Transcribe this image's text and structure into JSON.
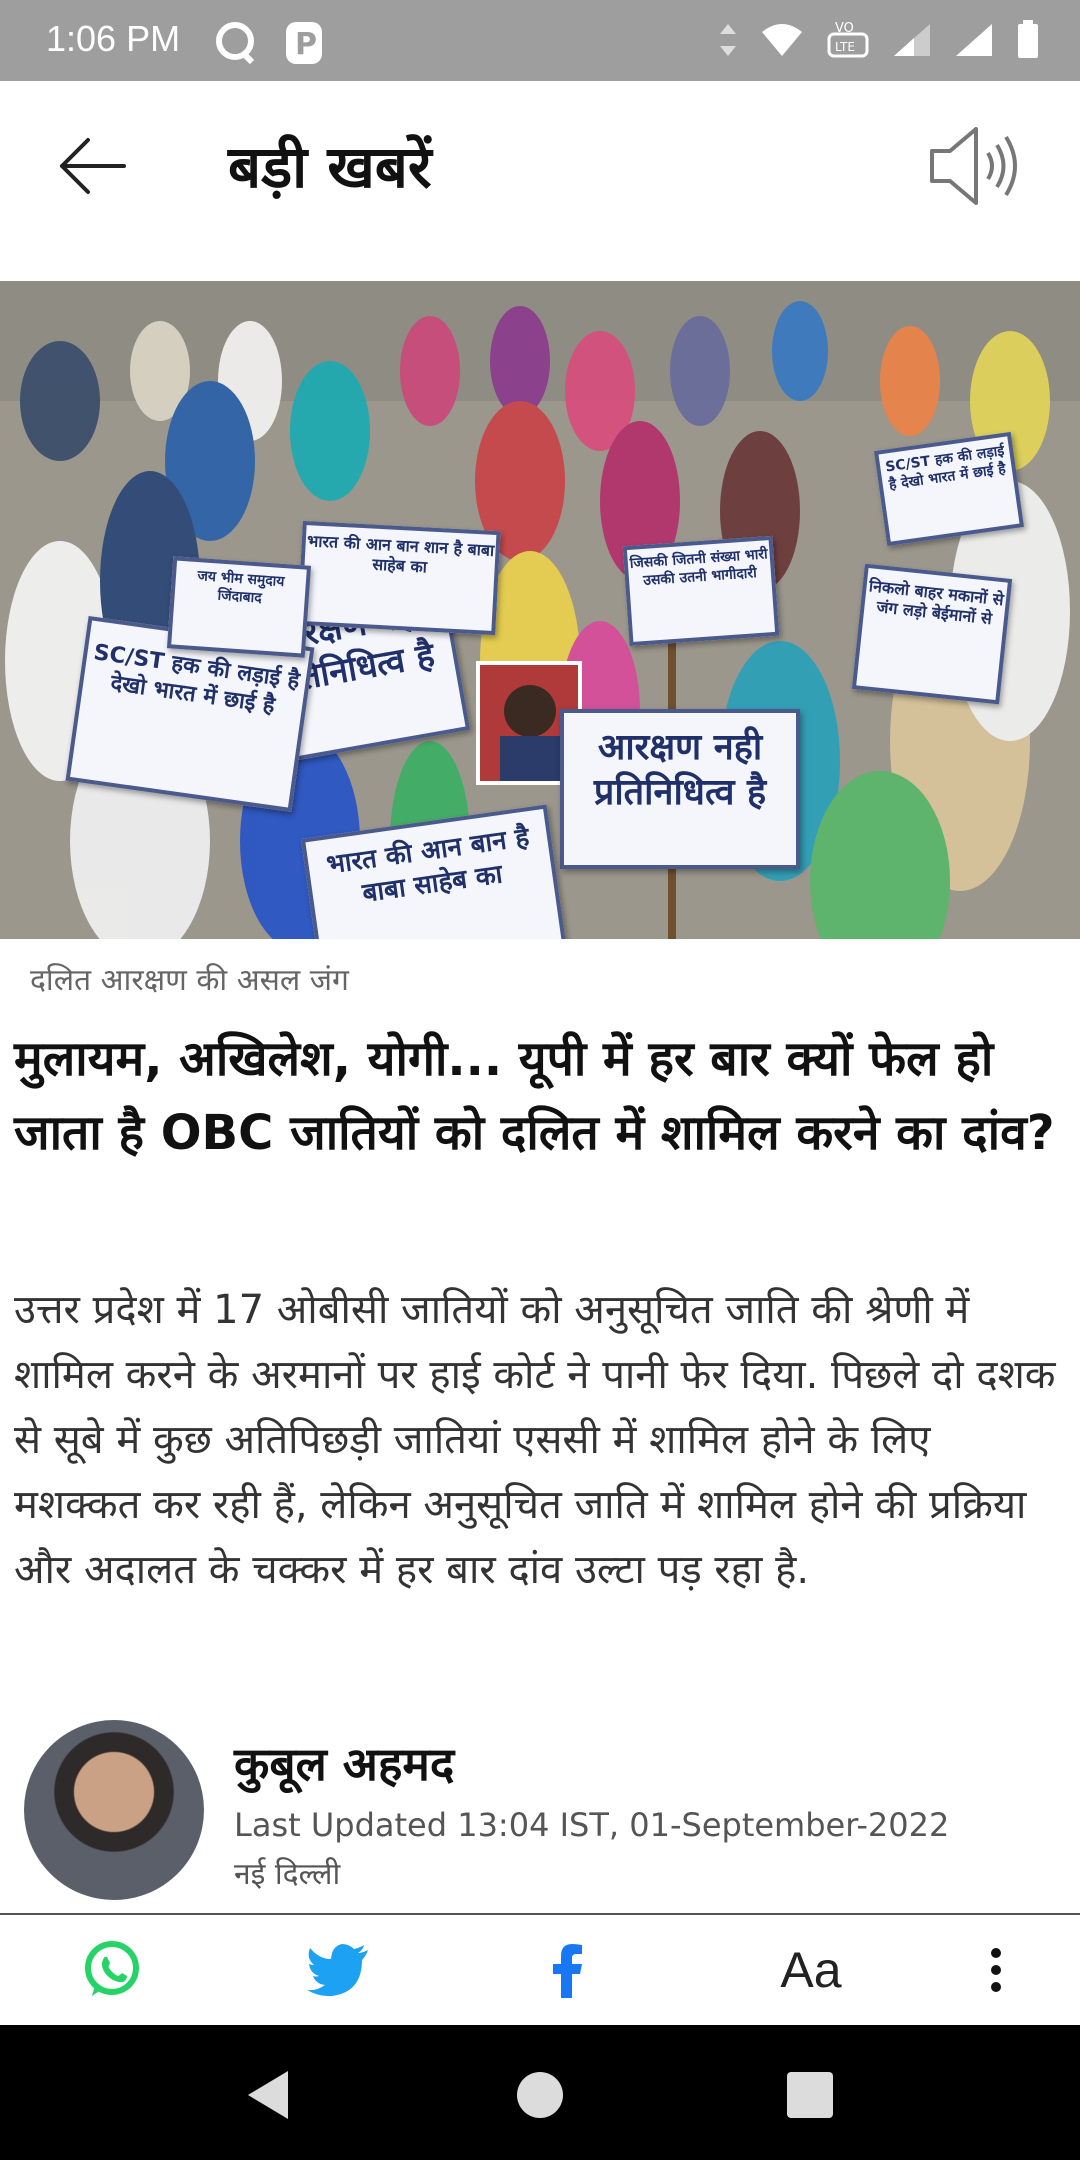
{
  "status_bar": {
    "time": "1:06 PM",
    "network_label": "VoLTE"
  },
  "app_bar": {
    "title": "बड़ी खबरें"
  },
  "hero_image": {
    "placards": [
      "आरक्षण नही प्रतिनिधित्व है",
      "आरक्षण नही प्रतिनिधित्व है",
      "SC/ST हक की लड़ाई है देखो भारत में छाई है",
      "SC/ST हक की लड़ाई है देखो भारत में छाई है",
      "भारत की आन बान शान है बाबा साहेब का",
      "भारत की आन बान है बाबा साहेब का",
      "जिसकी जितनी संख्या भारी उसकी उतनी भागीदारी",
      "जय भीम समुदाय जिंदाबाद",
      "निकलो बाहर मकानों से जंग लड़ो बेईमानों से"
    ]
  },
  "article": {
    "category_caption": "दलित आरक्षण की असल जंग",
    "headline": "मुलायम, अखिलेश, योगी... यूपी में हर बार क्यों फेल हो जाता है OBC जातियों को दलित में शामिल करने का दांव?",
    "summary": "उत्तर प्रदेश में 17 ओबीसी जातियों को अनुसूचित जाति की श्रेणी में शामिल करने के अरमानों पर हाई कोर्ट ने पानी फेर दिया. पिछले दो दशक से सूबे में कुछ अतिपिछड़ी जातियां एससी में शामिल होने के लिए मशक्कत कर रही हैं, लेकिन अनुसूचित जाति में शामिल होने की प्रक्रिया और अदालत के चक्कर में हर बार दांव उल्टा पड़ रहा है.",
    "author": {
      "name": "कुबूल अहमद",
      "updated": "Last Updated 13:04 IST, 01-September-2022",
      "location": "नई दिल्ली"
    }
  },
  "share_bar": {
    "items": [
      "whatsapp-icon",
      "twitter-icon",
      "facebook-icon",
      "font-size-icon",
      "more-options-icon"
    ],
    "font_size_label": "Aa"
  },
  "colors": {
    "status_bar_bg": "#9e9e9e",
    "whatsapp": "#25D366",
    "twitter": "#1DA1F2",
    "facebook": "#1877F2",
    "nav_bar_bg": "#000000"
  }
}
